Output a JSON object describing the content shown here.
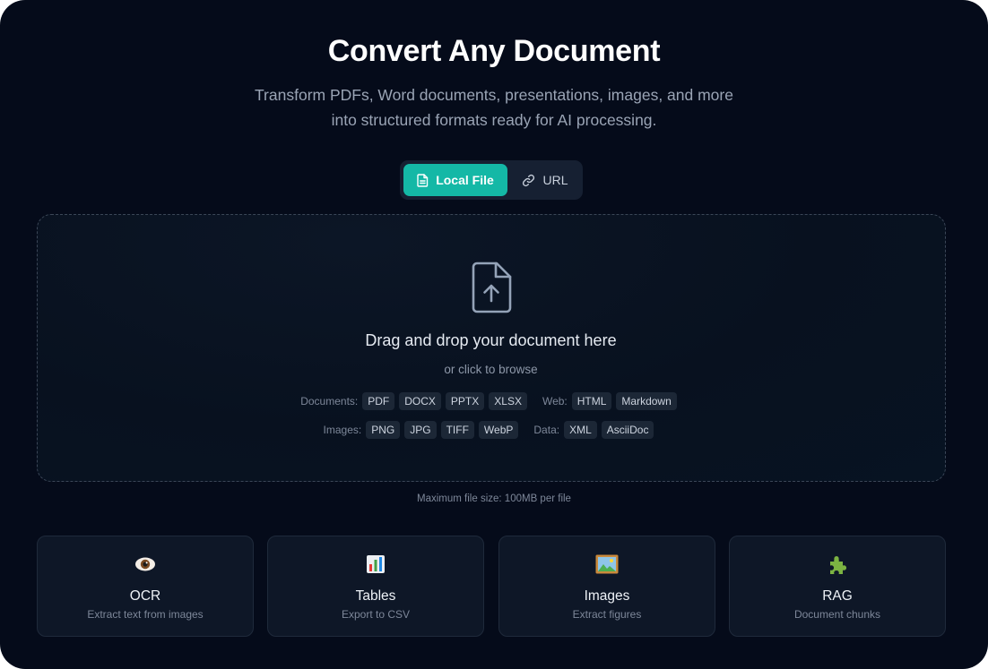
{
  "header": {
    "title": "Convert Any Document",
    "subtitle_line1": "Transform PDFs, Word documents, presentations, images, and more",
    "subtitle_line2": "into structured formats ready for AI processing."
  },
  "tabs": {
    "local": {
      "label": "Local File",
      "icon": "file-icon",
      "active": true
    },
    "url": {
      "label": "URL",
      "icon": "link-icon",
      "active": false
    }
  },
  "dropzone": {
    "icon": "file-upload-icon",
    "title": "Drag and drop your document here",
    "subtitle": "or click to browse",
    "groups": [
      {
        "label": "Documents:",
        "formats": [
          "PDF",
          "DOCX",
          "PPTX",
          "XLSX"
        ]
      },
      {
        "label": "Web:",
        "formats": [
          "HTML",
          "Markdown"
        ]
      },
      {
        "label": "Images:",
        "formats": [
          "PNG",
          "JPG",
          "TIFF",
          "WebP"
        ]
      },
      {
        "label": "Data:",
        "formats": [
          "XML",
          "AsciiDoc"
        ]
      }
    ]
  },
  "max_size": "Maximum file size: 100MB per file",
  "features": [
    {
      "icon": "eye-icon",
      "title": "OCR",
      "description": "Extract text from images"
    },
    {
      "icon": "bar-chart-icon",
      "title": "Tables",
      "description": "Export to CSV"
    },
    {
      "icon": "framed-picture-icon",
      "title": "Images",
      "description": "Extract figures"
    },
    {
      "icon": "puzzle-piece-icon",
      "title": "RAG",
      "description": "Document chunks"
    }
  ],
  "colors": {
    "background": "#050b1a",
    "accent": "#14b8a6",
    "card": "#0e1727",
    "chip": "#1c2736"
  }
}
